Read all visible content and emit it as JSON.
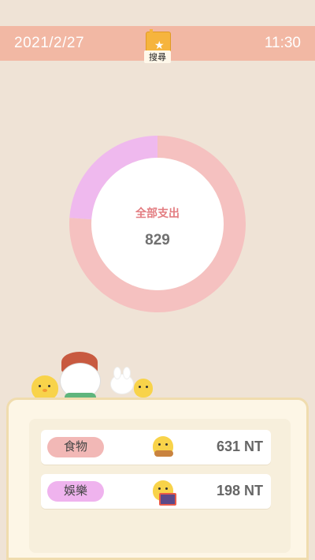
{
  "header": {
    "date": "2021/2/27",
    "time": "11:30",
    "search_label": "搜尋",
    "search_icon": "star-book-icon",
    "background": "#f2b8a4"
  },
  "summary": {
    "title": "全部支出",
    "total": "829"
  },
  "chart_data": {
    "type": "pie",
    "categories": [
      "食物",
      "娛樂"
    ],
    "values": [
      631,
      198
    ],
    "colors": [
      "#f5c1c0",
      "#efb9ee"
    ]
  },
  "categories": [
    {
      "label": "食物",
      "amount": "631 NT",
      "icon": "chick-pancake-icon",
      "color": "#f2b8b6"
    },
    {
      "label": "娛樂",
      "amount": "198 NT",
      "icon": "chick-headphones-tv-icon",
      "color": "#efb3ee"
    }
  ]
}
